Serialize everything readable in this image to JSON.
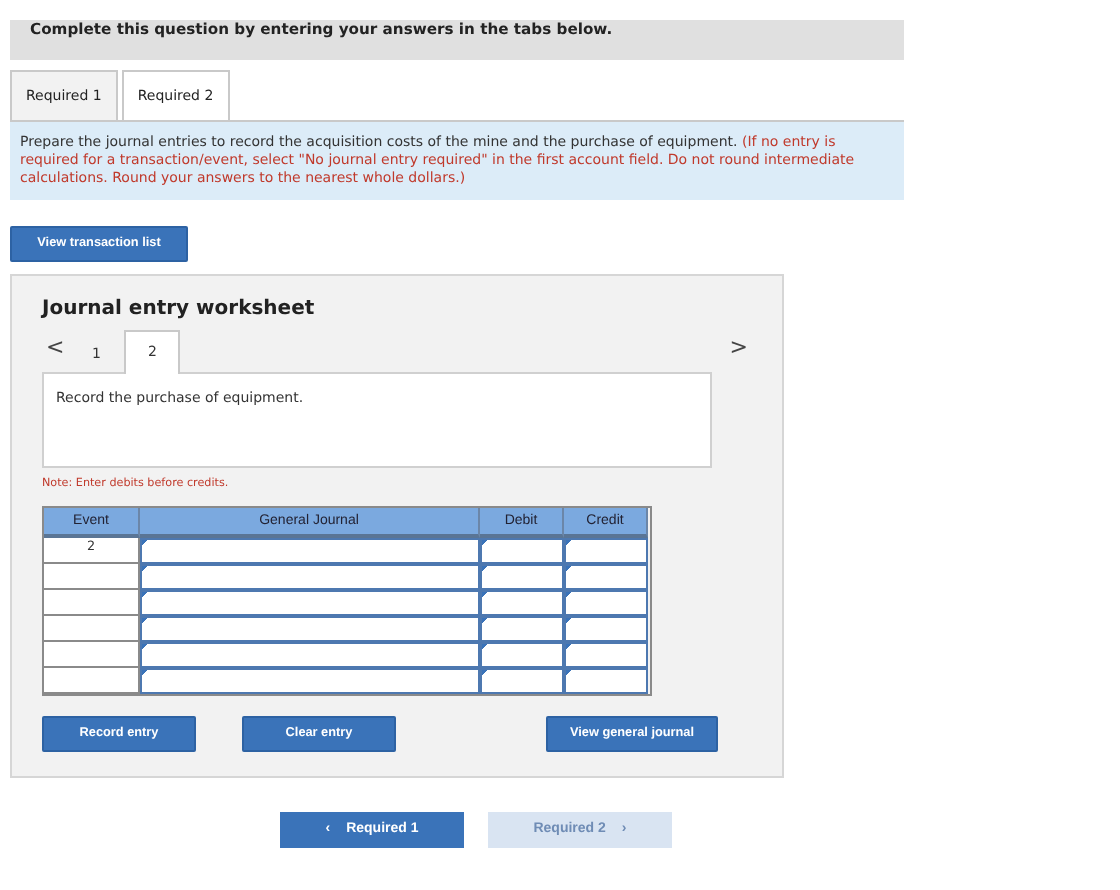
{
  "header": {
    "text": "Complete this question by entering your answers in the tabs below."
  },
  "tabs": [
    {
      "label": "Required 1",
      "selected": false
    },
    {
      "label": "Required 2",
      "selected": true
    }
  ],
  "instructions": {
    "text": "Prepare the journal entries to record the acquisition costs of the mine and the purchase of equipment.",
    "note": "(If no entry is required for a transaction/event, select \"No journal entry required\" in the first account field. Do not round intermediate calculations. Round your answers to the nearest whole dollars.)"
  },
  "view_transactions_button": "View transaction list",
  "worksheet": {
    "title": "Journal entry worksheet",
    "prev_icon": "<",
    "next_icon": ">",
    "tabs": [
      {
        "label": "1",
        "selected": false
      },
      {
        "label": "2",
        "selected": true
      }
    ],
    "description": "Record the purchase of equipment.",
    "note": "Note: Enter debits before credits.",
    "table": {
      "columns": [
        "Event",
        "General Journal",
        "Debit",
        "Credit"
      ],
      "rows": [
        {
          "event": "2"
        },
        {
          "event": null
        },
        {
          "event": null
        },
        {
          "event": null
        },
        {
          "event": null
        },
        {
          "event": null
        }
      ]
    },
    "buttons": [
      "Record entry",
      "Clear entry",
      "View general journal"
    ]
  },
  "nav": [
    {
      "icon_before": "‹",
      "label": "Required 1",
      "disabled": false
    },
    {
      "label": "Required 2",
      "icon_after": "›",
      "disabled": true
    }
  ]
}
